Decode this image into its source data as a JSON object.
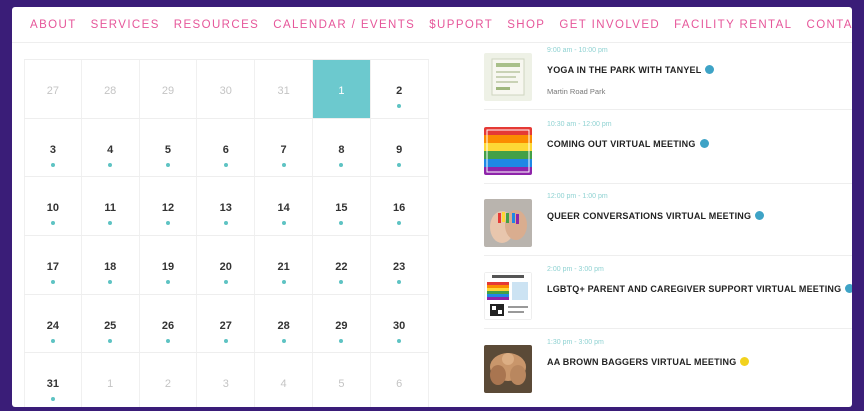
{
  "nav": [
    "About",
    "Services",
    "Resources",
    "Calendar / Events",
    "$upport",
    "Shop",
    "Get Involved",
    "Facility Rental",
    "Contact"
  ],
  "calendar": {
    "weeks": [
      [
        {
          "d": "27",
          "other": true
        },
        {
          "d": "28",
          "other": true
        },
        {
          "d": "29",
          "other": true
        },
        {
          "d": "30",
          "other": true
        },
        {
          "d": "31",
          "other": true
        },
        {
          "d": "1",
          "today": true
        },
        {
          "d": "2",
          "dot": true
        }
      ],
      [
        {
          "d": "3",
          "dot": true
        },
        {
          "d": "4",
          "dot": true
        },
        {
          "d": "5",
          "dot": true
        },
        {
          "d": "6",
          "dot": true
        },
        {
          "d": "7",
          "dot": true
        },
        {
          "d": "8",
          "dot": true
        },
        {
          "d": "9",
          "dot": true
        }
      ],
      [
        {
          "d": "10",
          "dot": true
        },
        {
          "d": "11",
          "dot": true
        },
        {
          "d": "12",
          "dot": true
        },
        {
          "d": "13",
          "dot": true
        },
        {
          "d": "14",
          "dot": true
        },
        {
          "d": "15",
          "dot": true
        },
        {
          "d": "16",
          "dot": true
        }
      ],
      [
        {
          "d": "17",
          "dot": true
        },
        {
          "d": "18",
          "dot": true
        },
        {
          "d": "19",
          "dot": true
        },
        {
          "d": "20",
          "dot": true
        },
        {
          "d": "21",
          "dot": true
        },
        {
          "d": "22",
          "dot": true
        },
        {
          "d": "23",
          "dot": true
        }
      ],
      [
        {
          "d": "24",
          "dot": true
        },
        {
          "d": "25",
          "dot": true
        },
        {
          "d": "26",
          "dot": true
        },
        {
          "d": "27",
          "dot": true
        },
        {
          "d": "28",
          "dot": true
        },
        {
          "d": "29",
          "dot": true
        },
        {
          "d": "30",
          "dot": true
        }
      ],
      [
        {
          "d": "31",
          "dot": true
        },
        {
          "d": "1",
          "other": true
        },
        {
          "d": "2",
          "other": true
        },
        {
          "d": "3",
          "other": true
        },
        {
          "d": "4",
          "other": true
        },
        {
          "d": "5",
          "other": true
        },
        {
          "d": "6",
          "other": true
        }
      ]
    ]
  },
  "events": [
    {
      "time": "9:00 am - 10:00 pm",
      "title": "Yoga in the Park with Tanyel",
      "dot": "#3ea3c6",
      "location": "Martin Road Park",
      "thumb": "poster"
    },
    {
      "time": "10:30 am - 12:00 pm",
      "title": "Coming Out Virtual Meeting",
      "dot": "#3ea3c6",
      "location": "",
      "thumb": "love"
    },
    {
      "time": "12:00 pm - 1:00 pm",
      "title": "Queer Conversations Virtual Meeting",
      "dot": "#3ea3c6",
      "location": "",
      "thumb": "hands"
    },
    {
      "time": "2:00 pm - 3:00 pm",
      "title": "LGBTQ+ Parent and Caregiver Support Virtual Meeting",
      "dot": "#3ea3c6",
      "location": "",
      "thumb": "flyer"
    },
    {
      "time": "1:30 pm - 3:00 pm",
      "title": "AA Brown Baggers Virtual Meeting",
      "dot": "#f2d21e",
      "location": "",
      "thumb": "group"
    }
  ]
}
